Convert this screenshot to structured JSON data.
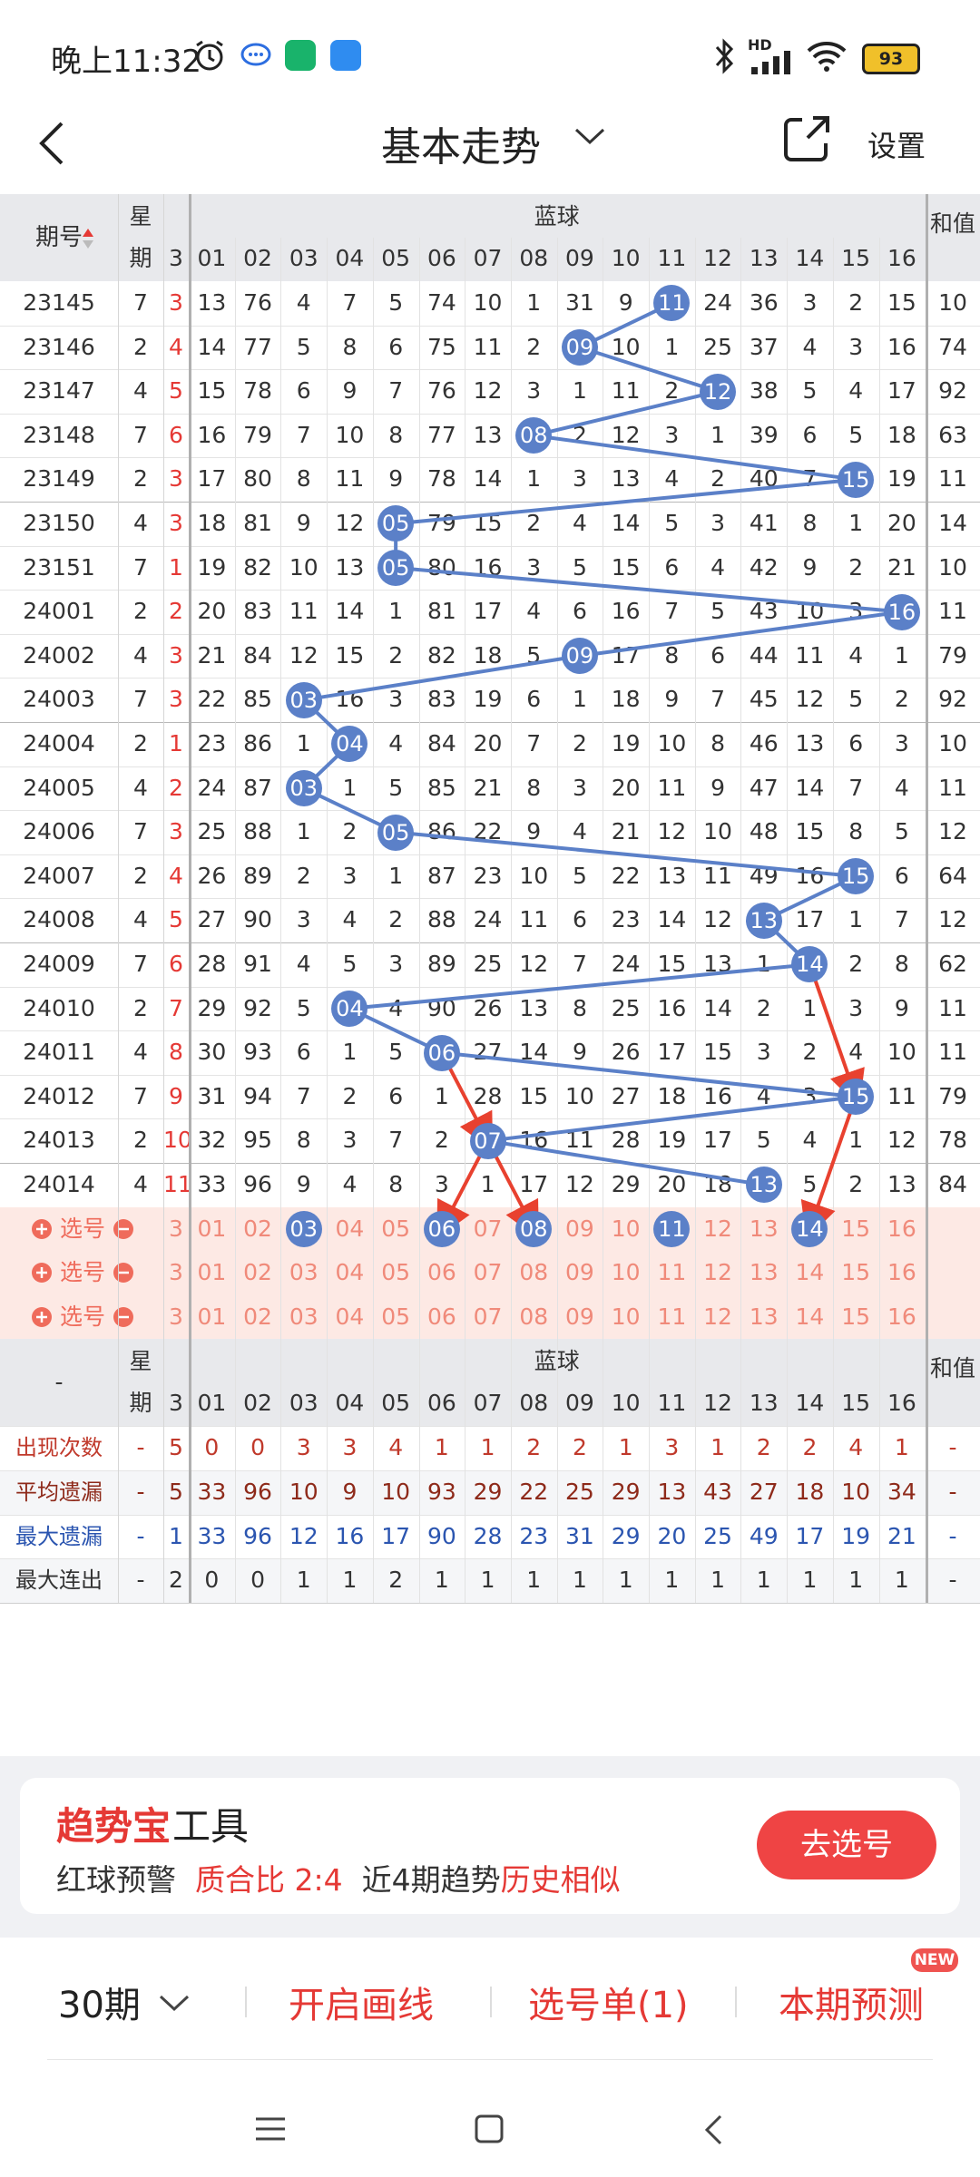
{
  "status_bar": {
    "time": "晚上11:32",
    "battery": "93",
    "network": "HD"
  },
  "nav": {
    "title": "基本走势",
    "settings": "设置"
  },
  "table": {
    "header_left": "期号",
    "header_week": [
      "星",
      "期"
    ],
    "header_blue": "蓝球",
    "header_sum": "和值",
    "prev_col": "3",
    "columns": [
      "01",
      "02",
      "03",
      "04",
      "05",
      "06",
      "07",
      "08",
      "09",
      "10",
      "11",
      "12",
      "13",
      "14",
      "15",
      "16"
    ],
    "rows": [
      {
        "issue": "23145",
        "week": "7",
        "prev": "3",
        "cells": [
          "13",
          "76",
          "4",
          "7",
          "5",
          "74",
          "10",
          "1",
          "31",
          "9",
          "11",
          "24",
          "36",
          "3",
          "2",
          "15"
        ],
        "sum": "10",
        "ball": 11
      },
      {
        "issue": "23146",
        "week": "2",
        "prev": "4",
        "cells": [
          "14",
          "77",
          "5",
          "8",
          "6",
          "75",
          "11",
          "2",
          "09",
          "10",
          "1",
          "25",
          "37",
          "4",
          "3",
          "16"
        ],
        "sum": "74",
        "ball": 9
      },
      {
        "issue": "23147",
        "week": "4",
        "prev": "5",
        "cells": [
          "15",
          "78",
          "6",
          "9",
          "7",
          "76",
          "12",
          "3",
          "1",
          "11",
          "2",
          "12",
          "38",
          "5",
          "4",
          "17"
        ],
        "sum": "92",
        "ball": 12
      },
      {
        "issue": "23148",
        "week": "7",
        "prev": "6",
        "cells": [
          "16",
          "79",
          "7",
          "10",
          "8",
          "77",
          "13",
          "08",
          "2",
          "12",
          "3",
          "1",
          "39",
          "6",
          "5",
          "18"
        ],
        "sum": "63",
        "ball": 8
      },
      {
        "issue": "23149",
        "week": "2",
        "prev": "3",
        "cells": [
          "17",
          "80",
          "8",
          "11",
          "9",
          "78",
          "14",
          "1",
          "3",
          "13",
          "4",
          "2",
          "40",
          "7",
          "15",
          "19"
        ],
        "sum": "11",
        "ball": 15
      },
      {
        "issue": "23150",
        "week": "4",
        "prev": "3",
        "cells": [
          "18",
          "81",
          "9",
          "12",
          "05",
          "79",
          "15",
          "2",
          "4",
          "14",
          "5",
          "3",
          "41",
          "8",
          "1",
          "20"
        ],
        "sum": "14",
        "ball": 5
      },
      {
        "issue": "23151",
        "week": "7",
        "prev": "1",
        "cells": [
          "19",
          "82",
          "10",
          "13",
          "05",
          "80",
          "16",
          "3",
          "5",
          "15",
          "6",
          "4",
          "42",
          "9",
          "2",
          "21"
        ],
        "sum": "10",
        "ball": 5
      },
      {
        "issue": "24001",
        "week": "2",
        "prev": "2",
        "cells": [
          "20",
          "83",
          "11",
          "14",
          "1",
          "81",
          "17",
          "4",
          "6",
          "16",
          "7",
          "5",
          "43",
          "10",
          "3",
          "16"
        ],
        "sum": "11",
        "ball": 16
      },
      {
        "issue": "24002",
        "week": "4",
        "prev": "3",
        "cells": [
          "21",
          "84",
          "12",
          "15",
          "2",
          "82",
          "18",
          "5",
          "09",
          "17",
          "8",
          "6",
          "44",
          "11",
          "4",
          "1"
        ],
        "sum": "79",
        "ball": 9
      },
      {
        "issue": "24003",
        "week": "7",
        "prev": "3",
        "cells": [
          "22",
          "85",
          "03",
          "16",
          "3",
          "83",
          "19",
          "6",
          "1",
          "18",
          "9",
          "7",
          "45",
          "12",
          "5",
          "2"
        ],
        "sum": "92",
        "ball": 3
      },
      {
        "issue": "24004",
        "week": "2",
        "prev": "1",
        "cells": [
          "23",
          "86",
          "1",
          "04",
          "4",
          "84",
          "20",
          "7",
          "2",
          "19",
          "10",
          "8",
          "46",
          "13",
          "6",
          "3"
        ],
        "sum": "10",
        "ball": 4
      },
      {
        "issue": "24005",
        "week": "4",
        "prev": "2",
        "cells": [
          "24",
          "87",
          "03",
          "1",
          "5",
          "85",
          "21",
          "8",
          "3",
          "20",
          "11",
          "9",
          "47",
          "14",
          "7",
          "4"
        ],
        "sum": "11",
        "ball": 3
      },
      {
        "issue": "24006",
        "week": "7",
        "prev": "3",
        "cells": [
          "25",
          "88",
          "1",
          "2",
          "05",
          "86",
          "22",
          "9",
          "4",
          "21",
          "12",
          "10",
          "48",
          "15",
          "8",
          "5"
        ],
        "sum": "12",
        "ball": 5
      },
      {
        "issue": "24007",
        "week": "2",
        "prev": "4",
        "cells": [
          "26",
          "89",
          "2",
          "3",
          "1",
          "87",
          "23",
          "10",
          "5",
          "22",
          "13",
          "11",
          "49",
          "16",
          "15",
          "6"
        ],
        "sum": "64",
        "ball": 15
      },
      {
        "issue": "24008",
        "week": "4",
        "prev": "5",
        "cells": [
          "27",
          "90",
          "3",
          "4",
          "2",
          "88",
          "24",
          "11",
          "6",
          "23",
          "14",
          "12",
          "13",
          "17",
          "1",
          "7"
        ],
        "sum": "12",
        "ball": 13
      },
      {
        "issue": "24009",
        "week": "7",
        "prev": "6",
        "cells": [
          "28",
          "91",
          "4",
          "5",
          "3",
          "89",
          "25",
          "12",
          "7",
          "24",
          "15",
          "13",
          "1",
          "14",
          "2",
          "8"
        ],
        "sum": "62",
        "ball": 14
      },
      {
        "issue": "24010",
        "week": "2",
        "prev": "7",
        "cells": [
          "29",
          "92",
          "5",
          "04",
          "4",
          "90",
          "26",
          "13",
          "8",
          "25",
          "16",
          "14",
          "2",
          "1",
          "3",
          "9"
        ],
        "sum": "11",
        "ball": 4
      },
      {
        "issue": "24011",
        "week": "4",
        "prev": "8",
        "cells": [
          "30",
          "93",
          "6",
          "1",
          "5",
          "06",
          "27",
          "14",
          "9",
          "26",
          "17",
          "15",
          "3",
          "2",
          "4",
          "10"
        ],
        "sum": "11",
        "ball": 6
      },
      {
        "issue": "24012",
        "week": "7",
        "prev": "9",
        "cells": [
          "31",
          "94",
          "7",
          "2",
          "6",
          "1",
          "28",
          "15",
          "10",
          "27",
          "18",
          "16",
          "4",
          "3",
          "15",
          "11"
        ],
        "sum": "79",
        "ball": 15
      },
      {
        "issue": "24013",
        "week": "2",
        "prev": "10",
        "cells": [
          "32",
          "95",
          "8",
          "3",
          "7",
          "2",
          "07",
          "16",
          "11",
          "28",
          "19",
          "17",
          "5",
          "4",
          "1",
          "12"
        ],
        "sum": "78",
        "ball": 7
      },
      {
        "issue": "24014",
        "week": "4",
        "prev": "11",
        "cells": [
          "33",
          "96",
          "9",
          "4",
          "8",
          "3",
          "1",
          "17",
          "12",
          "29",
          "20",
          "18",
          "13",
          "5",
          "2",
          "13"
        ],
        "sum": "84",
        "ball": 13
      }
    ],
    "select_label": "选号",
    "select_rows": [
      {
        "picked": [
          3,
          6,
          8,
          11,
          14
        ]
      },
      {
        "picked": []
      },
      {
        "picked": []
      }
    ],
    "stats": [
      {
        "label": "出现次数",
        "week": "-",
        "prev": "5",
        "values": [
          "0",
          "0",
          "3",
          "3",
          "4",
          "1",
          "1",
          "2",
          "2",
          "1",
          "3",
          "1",
          "2",
          "2",
          "4",
          "1"
        ],
        "sum": "-",
        "color": "#c0392b"
      },
      {
        "label": "平均遗漏",
        "week": "-",
        "prev": "5",
        "values": [
          "33",
          "96",
          "10",
          "9",
          "10",
          "93",
          "29",
          "22",
          "25",
          "29",
          "13",
          "43",
          "27",
          "18",
          "10",
          "34"
        ],
        "sum": "-",
        "color": "#8e2a1a"
      },
      {
        "label": "最大遗漏",
        "week": "-",
        "prev": "1",
        "values": [
          "33",
          "96",
          "12",
          "16",
          "17",
          "90",
          "28",
          "23",
          "31",
          "29",
          "20",
          "25",
          "49",
          "17",
          "19",
          "21"
        ],
        "sum": "-",
        "color": "#2b55b0"
      },
      {
        "label": "最大连出",
        "week": "-",
        "prev": "2",
        "values": [
          "0",
          "0",
          "1",
          "1",
          "2",
          "1",
          "1",
          "1",
          "1",
          "1",
          "1",
          "1",
          "1",
          "1",
          "1",
          "1"
        ],
        "sum": "-",
        "color": "#333333"
      }
    ]
  },
  "promo": {
    "title_red": "趋势宝",
    "title_black": "工具",
    "red_ball_label": "红球预警",
    "ratio": "质合比 2:4",
    "trend": "近4期趋势",
    "trend_red": "历史相似",
    "button": "去选号"
  },
  "toolbar": {
    "periods": "30期",
    "draw": "开启画线",
    "selection": "选号单(1)",
    "predict": "本期预测",
    "new_badge": "NEW"
  },
  "colors": {
    "ball_blue": "#5b80c8",
    "accent_red": "#e53935",
    "line_red": "#e8412f"
  }
}
